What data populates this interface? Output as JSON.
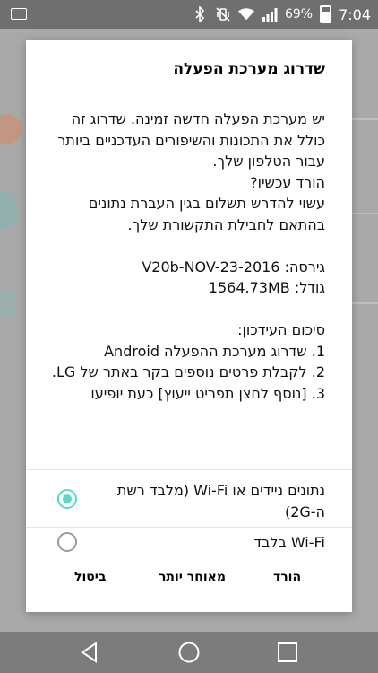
{
  "status_bar": {
    "battery": "69%",
    "time": "7:04",
    "icons": [
      "voicemail-icon",
      "bluetooth-icon",
      "vibrate-icon",
      "wifi-icon",
      "signal-icon",
      "battery-icon"
    ]
  },
  "dialog": {
    "title": "שדרוג מערכת הפעלה",
    "body": "יש מערכת הפעלה חדשה זמינה. שדרוג זה כולל את התכונות והשיפורים העדכניים ביותר עבור הטלפון שלך.\nהורד עכשיו?\nעשוי להדרש תשלום בגין העברת נתונים בהתאם לחבילת התקשורת שלך.\n\nגירסה: V20b-NOV-23-2016\nגודל: 1564.73MB\n\nסיכום העידכון:\n1. שדרוג מערכת ההפעלה Android\n2. לקבלת פרטים נוספים בקר באתר של LG.\n3. [נוסף לחצן תפריט ייעוץ] כעת יופיעו",
    "options": [
      {
        "label": "נתונים ניידים או Wi-Fi (מלבד רשת ה-2G)",
        "selected": true
      },
      {
        "label": "Wi-Fi בלבד",
        "selected": false
      }
    ],
    "buttons": {
      "download": "הורד",
      "later": "מאוחר יותר",
      "cancel": "ביטול"
    }
  },
  "colors": {
    "accent": "#5ed6c8",
    "status_bar": "#6f6f6f",
    "nav_bar": "#7c7c7c"
  },
  "nav_bar": {
    "icons": [
      "back-icon",
      "home-icon",
      "recents-icon"
    ]
  }
}
